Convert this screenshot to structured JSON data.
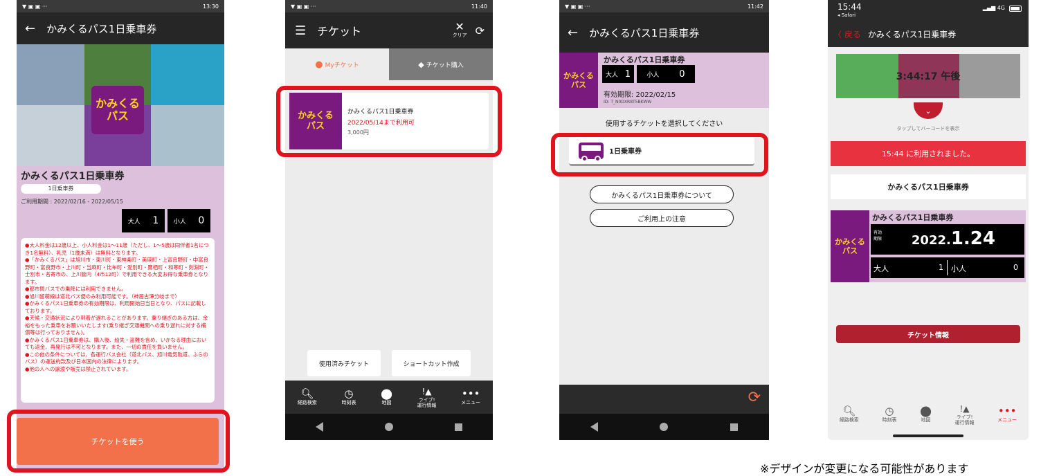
{
  "screen1": {
    "status_time": "13:30",
    "title": "かみくるパス1日乗車券",
    "logo_text": "かみくる\nパス",
    "ticket_name": "かみくるパス1日乗車券",
    "ticket_type": "1日乗車券",
    "period": "ご利用期間 : 2022/02/16 - 2022/05/15",
    "adult_label": "大人",
    "adult_count": "1",
    "child_label": "小人",
    "child_count": "0",
    "notes": "●大人料金は12歳以上、小人料金は1〜11歳（ただし、1〜5歳は同伴者1名につき1名無料）、乳児（1歳未満）は無料となります。\n●「かみくるパス」は旭川市・東川町・東神楽町・美瑛町・上富良野町・中富良野町・富良野市・上川町・当麻町・比布町・愛別町・鷹栖町・和寒町・剣淵町・士別市・名寄市の、上川管内（4市12町）で利用できる大変お得な乗車券となります。\n●都市間バスでの乗降には利用できません。\n●旭川留萌線は道北バス便のみ利用可能です。（神居古潭分岐まで）\n●かみくるパス1日乗車券の有効期限は、利用開始日当日となり、パスに記載しております。\n●天候・交通状況により到着が遅れることがあります。乗り継ぎのある方は、余裕をもった乗車をお願いいたします(乗り継ぎ交通機関への乗り遅れに対する補償等は行っておりません)。\n●かみくるパス1日乗車券は、購入後、紛失・盗難を含め、いかなる理由においても返金、再発行は不可となります。また、一切の責任を負いません。\n●この他の条件については、各運行バス会社（道北バス、旭川電気軌道、ふらのバス）の運送約款及び日本国内の法律によります。\n●他の人への譲渡や販売は禁止されています。",
    "use_button": "チケットを使う"
  },
  "screen2": {
    "status_time": "11:40",
    "title": "チケット",
    "clear_label": "クリア",
    "tab_my": "Myチケット",
    "tab_buy": "チケット購入",
    "logo_text": "かみくる\nパス",
    "ticket_name": "かみくるパス1日乗車券",
    "ticket_valid": "2022/05/14まで利用可",
    "ticket_price": "3,000円",
    "used_button": "使用済みチケット",
    "shortcut_button": "ショートカット作成",
    "tabs": [
      "経路検索",
      "時刻表",
      "地図",
      "ライブ!\n運行情報",
      "メニュー"
    ]
  },
  "screen3": {
    "status_time": "11:42",
    "title": "かみくるパス1日乗車券",
    "logo_text": "かみくる\nパス",
    "card_name": "かみくるパス1日乗車券",
    "adult_label": "大人",
    "adult_count": "1",
    "child_label": "小人",
    "child_count": "0",
    "expiry": "有効期限: 2022/02/15",
    "ticket_id": "ID: T_N0DXR8T5BKWW",
    "instruction": "使用するチケットを選択してください",
    "option": "1日乗車券",
    "about_button": "かみくるパス1日乗車券について",
    "caution_button": "ご利用上の注意"
  },
  "screen4": {
    "status_time": "15:44",
    "back_app": "◂ Safari",
    "signal": "4G",
    "back": "戻る",
    "title": "かみくるパス1日乗車券",
    "clock": "3:44:17 午後",
    "barcode_hint": "タップしてバーコードを表示",
    "used_notice": "15:44 に利用されました。",
    "ticket_name": "かみくるパス1日乗車券",
    "card_name": "かみくるパス1日乗車券",
    "logo_text": "かみくる\nパス",
    "validity_label": "有効\n期限",
    "date_prefix": "2022.",
    "date_main": "1.24",
    "adult_label": "大人",
    "adult_count": "1",
    "child_label": "小人",
    "child_count": "0",
    "info_button": "チケット情報",
    "tabs": [
      "経路検索",
      "時刻表",
      "地図",
      "ライブ!\n運行情報",
      "メニュー"
    ]
  },
  "footnote": "※デザインが変更になる可能性があります",
  "colors": {
    "accent": "#f2714a",
    "highlight": "#e0141e",
    "brand": "#7b1a7e",
    "used": "#e8323f"
  }
}
